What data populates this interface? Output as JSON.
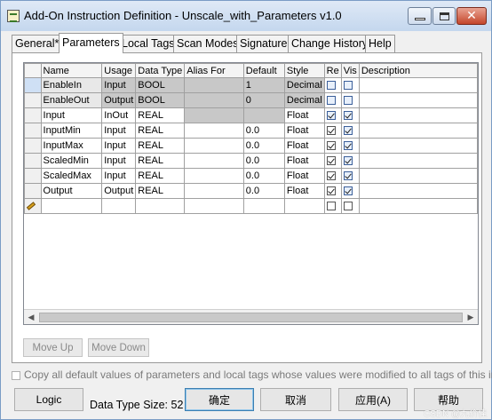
{
  "window": {
    "title": "Add-On Instruction Definition - Unscale_with_Parameters v1.0",
    "controls": {
      "minimize": "minimize",
      "maximize": "maximize",
      "close": "✕"
    }
  },
  "tabs": [
    {
      "label": "General*"
    },
    {
      "label": "Parameters",
      "active": true
    },
    {
      "label": "Local Tags"
    },
    {
      "label": "Scan Modes"
    },
    {
      "label": "Signature"
    },
    {
      "label": "Change History"
    },
    {
      "label": "Help"
    }
  ],
  "grid": {
    "columns": [
      "Name",
      "Usage",
      "Data Type",
      "Alias For",
      "Default",
      "Style",
      "Re",
      "Vis",
      "Description"
    ],
    "rows": [
      {
        "name": "EnableIn",
        "usage": "Input",
        "data_type": "BOOL",
        "alias_for": "",
        "default": "1",
        "style": "Decimal",
        "re": false,
        "vis": false
      },
      {
        "name": "EnableOut",
        "usage": "Output",
        "data_type": "BOOL",
        "alias_for": "",
        "default": "0",
        "style": "Decimal",
        "re": false,
        "vis": false
      },
      {
        "name": "Input",
        "usage": "InOut",
        "data_type": "REAL",
        "alias_for": "",
        "default": "",
        "style": "Float",
        "re": true,
        "vis": true
      },
      {
        "name": "InputMin",
        "usage": "Input",
        "data_type": "REAL",
        "alias_for": "",
        "default": "0.0",
        "style": "Float",
        "re": true,
        "vis": true
      },
      {
        "name": "InputMax",
        "usage": "Input",
        "data_type": "REAL",
        "alias_for": "",
        "default": "0.0",
        "style": "Float",
        "re": true,
        "vis": true
      },
      {
        "name": "ScaledMin",
        "usage": "Input",
        "data_type": "REAL",
        "alias_for": "",
        "default": "0.0",
        "style": "Float",
        "re": true,
        "vis": true
      },
      {
        "name": "ScaledMax",
        "usage": "Input",
        "data_type": "REAL",
        "alias_for": "",
        "default": "0.0",
        "style": "Float",
        "re": true,
        "vis": true
      },
      {
        "name": "Output",
        "usage": "Output",
        "data_type": "REAL",
        "alias_for": "",
        "default": "0.0",
        "style": "Float",
        "re": true,
        "vis": true
      }
    ]
  },
  "buttons": {
    "move_up": "Move Up",
    "move_down": "Move Down",
    "logic": "Logic",
    "ok": "确定",
    "cancel": "取消",
    "apply": "应用(A)",
    "help": "帮助"
  },
  "copy_defaults": {
    "label": "Copy all default values of parameters and local tags whose values were modified to all tags of this instr",
    "checked": false
  },
  "data_type_size": "Data Type Size: 52",
  "watermark": "CSDN @九价佳",
  "colors": {
    "selected_row": "#cfe0f5",
    "gray_cell": "#c8c8c8",
    "checkbox_blue": "#3b5f9a"
  }
}
